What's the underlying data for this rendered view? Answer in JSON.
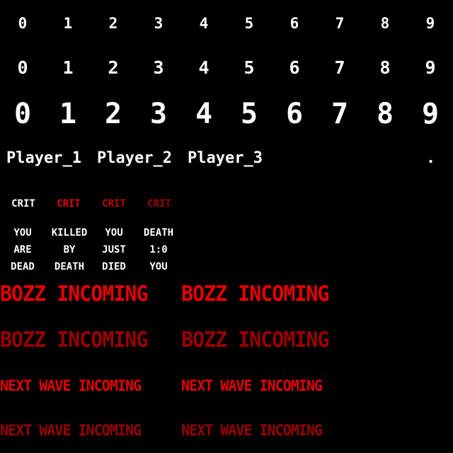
{
  "digits": [
    "0",
    "1",
    "2",
    "3",
    "4",
    "5",
    "6",
    "7",
    "8",
    "9"
  ],
  "players": [
    "Player_1",
    "Player_2",
    "Player_3"
  ],
  "dot": ".",
  "crits": [
    {
      "text": "CRIT",
      "color": "#ffffff"
    },
    {
      "text": "CRIT",
      "color": "#e60000"
    },
    {
      "text": "CRIT",
      "color": "#c40000"
    },
    {
      "text": "CRIT",
      "color": "#a00000"
    }
  ],
  "death_messages": [
    [
      "YOU",
      "ARE",
      "DEAD"
    ],
    [
      "KILLED",
      "BY",
      "DEATH"
    ],
    [
      "YOU",
      "JUST",
      "DIED"
    ],
    [
      "DEATH",
      "1:0",
      "YOU"
    ]
  ],
  "banners": {
    "boss_text": "BOZZ INCOMING",
    "wave_text": "NEXT WAVE INCOMING",
    "bright_red": "#e60000",
    "dark_red": "#9a0000"
  }
}
